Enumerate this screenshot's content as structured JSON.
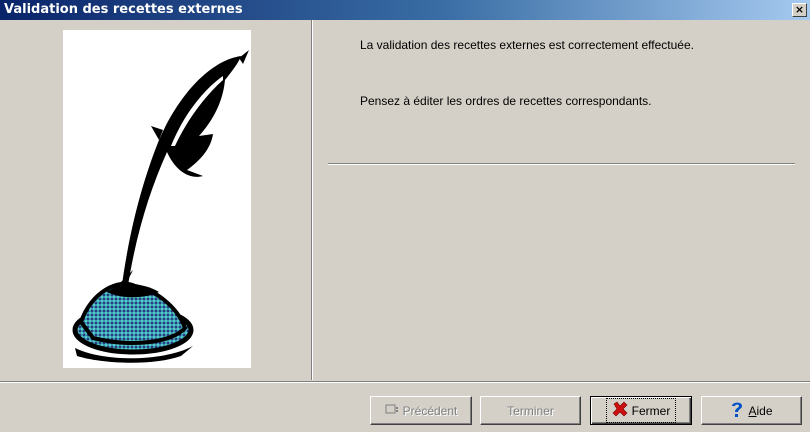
{
  "window": {
    "title": "Validation des recettes externes",
    "close_glyph": "×"
  },
  "content": {
    "message_1": "La validation des recettes externes est correctement effectuée.",
    "message_2": "Pensez à éditer les ordres de recettes correspondants."
  },
  "buttons": {
    "previous": "Précédent",
    "finish": "Terminer",
    "close": "Fermer",
    "help_first": "A",
    "help_rest": "ide"
  },
  "icons": {
    "illustration": "quill-inkwell-icon",
    "previous": "previous-arrow-icon",
    "close": "red-x-icon",
    "help": "question-mark-icon"
  },
  "colors": {
    "titlebar_start": "#0a246a",
    "titlebar_end": "#a6caf0",
    "face": "#d4d0c8",
    "close_x": "#cc1010",
    "help_icon": "#0050c8"
  }
}
